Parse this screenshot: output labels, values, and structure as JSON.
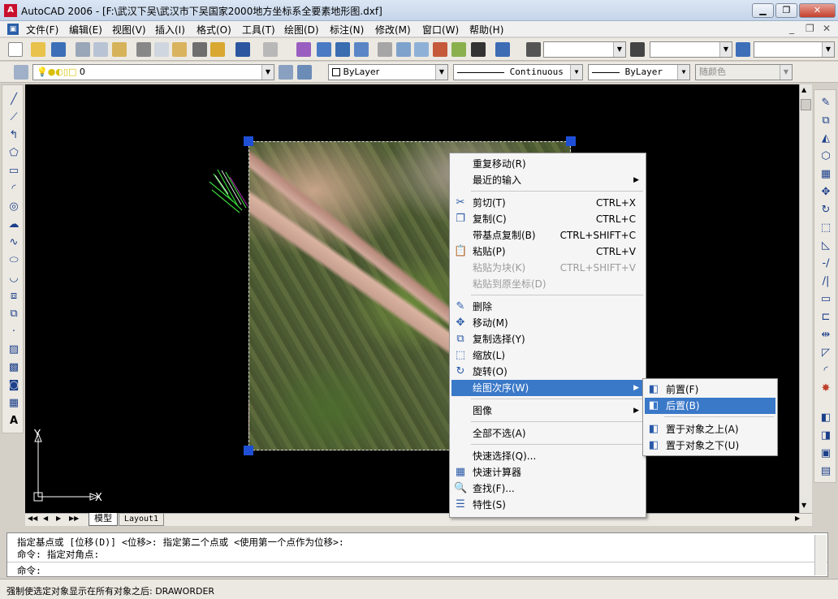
{
  "window": {
    "app_icon": "autocad-logo-icon",
    "title": "AutoCAD 2006 - [F:\\武汉下吴\\武汉市下吴国家2000地方坐标系全要素地形图.dxf]",
    "min_label": "▁",
    "max_label": "❐",
    "close_label": "✕"
  },
  "menubar": {
    "items": [
      "文件(F)",
      "编辑(E)",
      "视图(V)",
      "插入(I)",
      "格式(O)",
      "工具(T)",
      "绘图(D)",
      "标注(N)",
      "修改(M)",
      "窗口(W)",
      "帮助(H)"
    ],
    "doc_controls": [
      "_",
      "❐",
      "✕"
    ]
  },
  "properties_toolbar": {
    "layer_value": "0",
    "color_value": "ByLayer",
    "linetype_value": "Continuous",
    "lineweight_value": "ByLayer",
    "plotstyle_value": "随颜色"
  },
  "layout_tabs": {
    "nav": [
      "◀◀",
      "◀",
      "▶",
      "▶▶"
    ],
    "tabs": [
      "模型",
      "Layout1"
    ]
  },
  "ucs": {
    "x_label": "X",
    "y_label": "Y"
  },
  "context_menu": {
    "items": [
      {
        "label": "重复移动(R)",
        "shortcut": "",
        "icon": "",
        "state": "normal",
        "sub": false
      },
      {
        "label": "最近的输入",
        "shortcut": "",
        "icon": "",
        "state": "normal",
        "sub": true
      },
      {
        "sep": true
      },
      {
        "label": "剪切(T)",
        "shortcut": "CTRL+X",
        "icon": "✂",
        "state": "normal",
        "sub": false
      },
      {
        "label": "复制(C)",
        "shortcut": "CTRL+C",
        "icon": "❐",
        "state": "normal",
        "sub": false
      },
      {
        "label": "带基点复制(B)",
        "shortcut": "CTRL+SHIFT+C",
        "icon": "",
        "state": "normal",
        "sub": false
      },
      {
        "label": "粘贴(P)",
        "shortcut": "CTRL+V",
        "icon": "📋",
        "state": "normal",
        "sub": false
      },
      {
        "label": "粘贴为块(K)",
        "shortcut": "CTRL+SHIFT+V",
        "icon": "",
        "state": "disabled",
        "sub": false
      },
      {
        "label": "粘贴到原坐标(D)",
        "shortcut": "",
        "icon": "",
        "state": "disabled",
        "sub": false
      },
      {
        "sep": true
      },
      {
        "label": "删除",
        "shortcut": "",
        "icon": "✎",
        "state": "normal",
        "sub": false
      },
      {
        "label": "移动(M)",
        "shortcut": "",
        "icon": "✥",
        "state": "normal",
        "sub": false
      },
      {
        "label": "复制选择(Y)",
        "shortcut": "",
        "icon": "⧉",
        "state": "normal",
        "sub": false
      },
      {
        "label": "缩放(L)",
        "shortcut": "",
        "icon": "⬚",
        "state": "normal",
        "sub": false
      },
      {
        "label": "旋转(O)",
        "shortcut": "",
        "icon": "↻",
        "state": "normal",
        "sub": false
      },
      {
        "label": "绘图次序(W)",
        "shortcut": "",
        "icon": "",
        "state": "highlight",
        "sub": true
      },
      {
        "sep": true
      },
      {
        "label": "图像",
        "shortcut": "",
        "icon": "",
        "state": "normal",
        "sub": true
      },
      {
        "sep": true
      },
      {
        "label": "全部不选(A)",
        "shortcut": "",
        "icon": "",
        "state": "normal",
        "sub": false
      },
      {
        "sep": true
      },
      {
        "label": "快速选择(Q)...",
        "shortcut": "",
        "icon": "",
        "state": "normal",
        "sub": false
      },
      {
        "label": "快速计算器",
        "shortcut": "",
        "icon": "▦",
        "state": "normal",
        "sub": false
      },
      {
        "label": "查找(F)...",
        "shortcut": "",
        "icon": "🔍",
        "state": "normal",
        "sub": false
      },
      {
        "label": "特性(S)",
        "shortcut": "",
        "icon": "☰",
        "state": "normal",
        "sub": false
      }
    ]
  },
  "submenu": {
    "items": [
      {
        "label": "前置(F)",
        "state": "normal"
      },
      {
        "label": "后置(B)",
        "state": "highlight"
      },
      {
        "sep": true
      },
      {
        "label": "置于对象之上(A)",
        "state": "normal"
      },
      {
        "label": "置于对象之下(U)",
        "state": "normal"
      }
    ]
  },
  "command": {
    "line1": "指定基点或 [位移(D)] <位移>:  指定第二个点或 <使用第一个点作为位移>:",
    "line2": "命令: 指定对角点:",
    "prompt": "命令:"
  },
  "status": {
    "text": "强制使选定对象显示在所有对象之后:  DRAWORDER"
  },
  "colors": {
    "canvas": "#000000",
    "grip": "#1e4fd6",
    "highlight": "#3a78c8"
  }
}
